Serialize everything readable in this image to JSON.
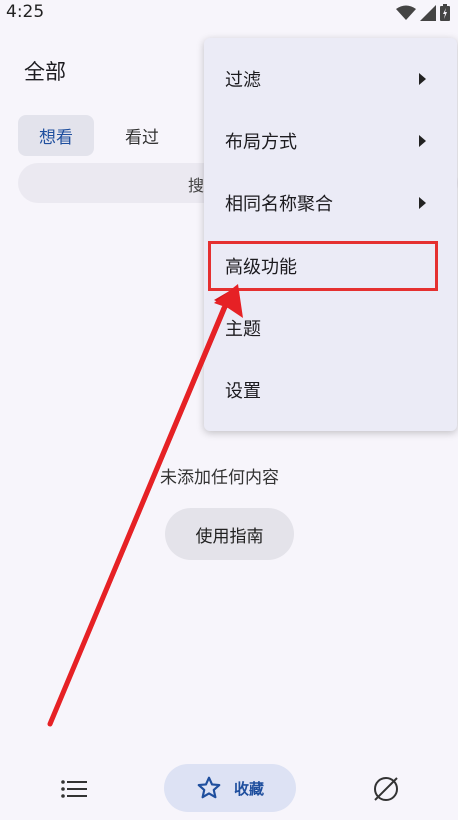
{
  "status_bar": {
    "time": "4:25"
  },
  "header": {
    "title": "全部"
  },
  "tabs": [
    {
      "label": "想看",
      "active": true
    },
    {
      "label": "看过",
      "active": false
    }
  ],
  "search": {
    "label": "搜"
  },
  "empty_state": {
    "message": "未添加任何内容",
    "guide_button": "使用指南"
  },
  "menu": {
    "items": [
      {
        "label": "过滤",
        "has_submenu": true
      },
      {
        "label": "布局方式",
        "has_submenu": true
      },
      {
        "label": "相同名称聚合",
        "has_submenu": true
      },
      {
        "label": "高级功能",
        "has_submenu": false,
        "highlighted": true
      },
      {
        "label": "主题",
        "has_submenu": false
      },
      {
        "label": "设置",
        "has_submenu": false
      }
    ]
  },
  "bottom_nav": {
    "items": [
      {
        "icon": "list-icon",
        "label": ""
      },
      {
        "icon": "star-icon",
        "label": "收藏",
        "active": true
      },
      {
        "icon": "explore-icon",
        "label": ""
      }
    ]
  },
  "colors": {
    "accent": "#1f4f9e",
    "annotation": "#e53030"
  }
}
